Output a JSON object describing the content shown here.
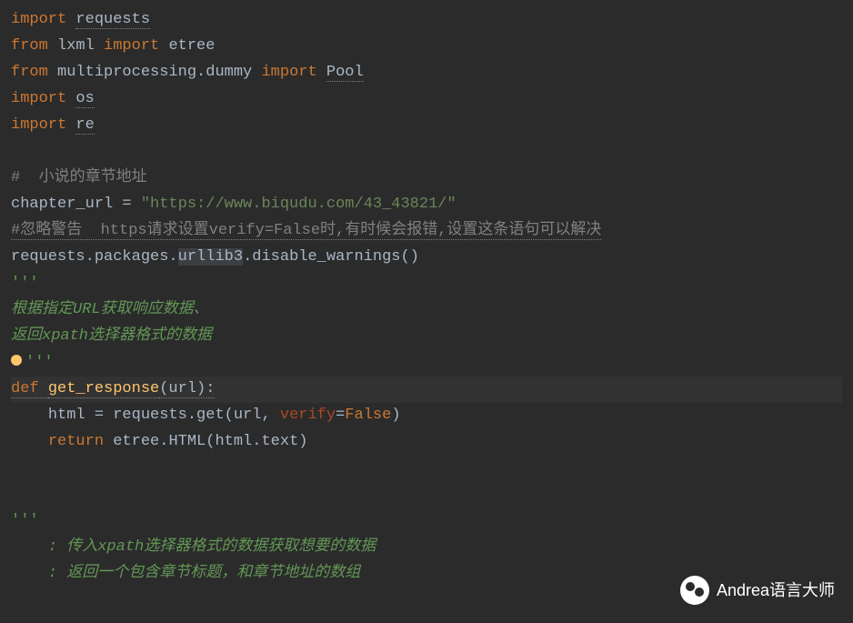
{
  "code": {
    "line1": {
      "import": "import",
      "module": "requests"
    },
    "line2": {
      "from": "from",
      "module": "lxml",
      "import": "import",
      "name": "etree"
    },
    "line3": {
      "from": "from",
      "module": "multiprocessing.dummy",
      "import": "import",
      "name": "Pool"
    },
    "line4": {
      "import": "import",
      "module": "os"
    },
    "line5": {
      "import": "import",
      "module": "re"
    },
    "line7": {
      "comment": "#  小说的章节地址"
    },
    "line8": {
      "var": "chapter_url",
      "eq": " = ",
      "url": "\"https://www.biqudu.com/43_43821/\""
    },
    "line9": {
      "comment": "#忽略警告  https请求设置verify=False时,有时候会报错,设置这条语句可以解决"
    },
    "line10": {
      "text1": "requests.packages.",
      "text2": "urllib3",
      "text3": ".disable_warnings()"
    },
    "line11": {
      "quote": "'''"
    },
    "line12": {
      "text": "根据指定URL获取响应数据、"
    },
    "line13": {
      "text": "返回xpath选择器格式的数据"
    },
    "line14": {
      "quote": "'''"
    },
    "line15": {
      "def": "def ",
      "func": "get_response",
      "params": "(url):"
    },
    "line16": {
      "indent": "    ",
      "var": "html",
      "eq": " = ",
      "call1": "requests.get(url",
      "comma": ", ",
      "kwarg": "verify",
      "eq2": "=",
      "false": "False",
      "close": ")"
    },
    "line17": {
      "indent": "    ",
      "return": "return ",
      "call": "etree.HTML(html.text)"
    },
    "line20": {
      "quote": "'''"
    },
    "line21": {
      "text": "    : 传入xpath选择器格式的数据获取想要的数据"
    },
    "line22": {
      "text": "    : 返回一个包含章节标题，和章节地址的数组"
    }
  },
  "watermark": {
    "text": "Andrea语言大师"
  }
}
